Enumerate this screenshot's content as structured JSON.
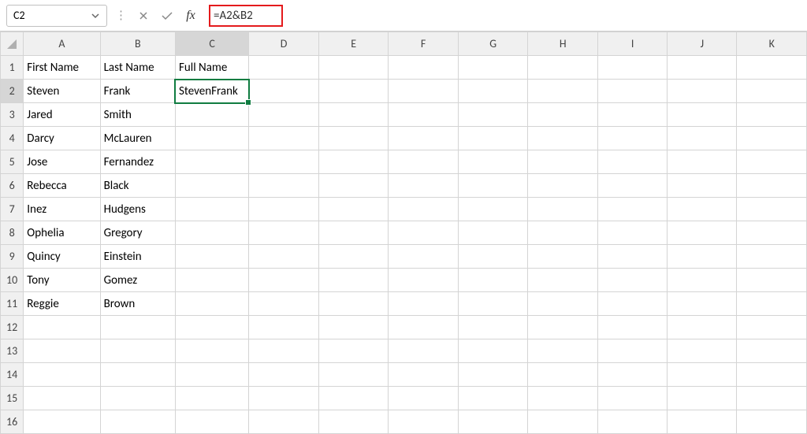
{
  "formula_bar": {
    "name_box": "C2",
    "formula": "=A2&B2"
  },
  "columns": [
    "A",
    "B",
    "C",
    "D",
    "E",
    "F",
    "G",
    "H",
    "I",
    "J",
    "K"
  ],
  "row_count": 16,
  "selected_cell": "C2",
  "data": {
    "1": {
      "A": "First Name",
      "B": "Last Name",
      "C": "Full Name"
    },
    "2": {
      "A": "Steven",
      "B": "Frank",
      "C": "StevenFrank"
    },
    "3": {
      "A": "Jared",
      "B": "Smith"
    },
    "4": {
      "A": "Darcy",
      "B": "McLauren"
    },
    "5": {
      "A": "Jose",
      "B": "Fernandez"
    },
    "6": {
      "A": "Rebecca",
      "B": "Black"
    },
    "7": {
      "A": "Inez",
      "B": "Hudgens"
    },
    "8": {
      "A": "Ophelia",
      "B": "Gregory"
    },
    "9": {
      "A": "Quincy",
      "B": "Einstein"
    },
    "10": {
      "A": "Tony",
      "B": "Gomez"
    },
    "11": {
      "A": "Reggie",
      "B": "Brown"
    }
  }
}
